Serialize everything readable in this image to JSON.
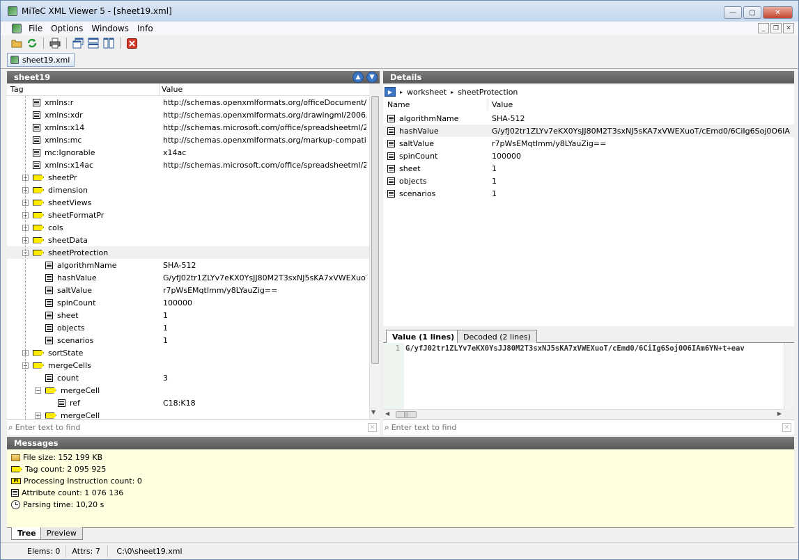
{
  "window": {
    "title": "MiTeC XML Viewer 5 - [sheet19.xml]"
  },
  "menu": [
    "File",
    "Options",
    "Windows",
    "Info"
  ],
  "doc_tab": {
    "label": "sheet19.xml"
  },
  "left_panel": {
    "title": "sheet19",
    "col_tag": "Tag",
    "col_value": "Value",
    "rows": [
      {
        "type": "attr",
        "tag": "xmlns:r",
        "value": "http://schemas.openxmlformats.org/officeDocument/200...",
        "depth": 1
      },
      {
        "type": "attr",
        "tag": "xmlns:xdr",
        "value": "http://schemas.openxmlformats.org/drawingml/2006/spr...",
        "depth": 1
      },
      {
        "type": "attr",
        "tag": "xmlns:x14",
        "value": "http://schemas.microsoft.com/office/spreadsheetml/2009...",
        "depth": 1
      },
      {
        "type": "attr",
        "tag": "xmlns:mc",
        "value": "http://schemas.openxmlformats.org/markup-compatibility...",
        "depth": 1
      },
      {
        "type": "attr",
        "tag": "mc:Ignorable",
        "value": "x14ac",
        "depth": 1
      },
      {
        "type": "attr",
        "tag": "xmlns:x14ac",
        "value": "http://schemas.microsoft.com/office/spreadsheetml/2009...",
        "depth": 1
      },
      {
        "type": "tag",
        "tag": "sheetPr",
        "value": "",
        "depth": 1,
        "exp": "+"
      },
      {
        "type": "tag",
        "tag": "dimension",
        "value": "",
        "depth": 1,
        "exp": "+"
      },
      {
        "type": "tag",
        "tag": "sheetViews",
        "value": "",
        "depth": 1,
        "exp": "+"
      },
      {
        "type": "tag",
        "tag": "sheetFormatPr",
        "value": "",
        "depth": 1,
        "exp": "+"
      },
      {
        "type": "tag",
        "tag": "cols",
        "value": "",
        "depth": 1,
        "exp": "+"
      },
      {
        "type": "tag",
        "tag": "sheetData",
        "value": "",
        "depth": 1,
        "exp": "+"
      },
      {
        "type": "tag",
        "tag": "sheetProtection",
        "value": "",
        "depth": 1,
        "exp": "-",
        "selected": true
      },
      {
        "type": "attr",
        "tag": "algorithmName",
        "value": "SHA-512",
        "depth": 2
      },
      {
        "type": "attr",
        "tag": "hashValue",
        "value": "G/yfJ02tr1ZLYv7eKX0YsJJ80M2T3sxNJ5sKA7xVWEXuoT/c...",
        "depth": 2
      },
      {
        "type": "attr",
        "tag": "saltValue",
        "value": "r7pWsEMqtImm/y8LYauZig==",
        "depth": 2
      },
      {
        "type": "attr",
        "tag": "spinCount",
        "value": "100000",
        "depth": 2
      },
      {
        "type": "attr",
        "tag": "sheet",
        "value": "1",
        "depth": 2
      },
      {
        "type": "attr",
        "tag": "objects",
        "value": "1",
        "depth": 2
      },
      {
        "type": "attr",
        "tag": "scenarios",
        "value": "1",
        "depth": 2
      },
      {
        "type": "tag",
        "tag": "sortState",
        "value": "",
        "depth": 1,
        "exp": "+"
      },
      {
        "type": "tag",
        "tag": "mergeCells",
        "value": "",
        "depth": 1,
        "exp": "-"
      },
      {
        "type": "attr",
        "tag": "count",
        "value": "3",
        "depth": 2
      },
      {
        "type": "tag",
        "tag": "mergeCell",
        "value": "",
        "depth": 2,
        "exp": "-"
      },
      {
        "type": "attr",
        "tag": "ref",
        "value": "C18:K18",
        "depth": 3
      },
      {
        "type": "tag",
        "tag": "mergeCell",
        "value": "",
        "depth": 2,
        "exp": "+"
      }
    ],
    "find_placeholder": "Enter text to find"
  },
  "right_panel": {
    "title": "Details",
    "breadcrumb": [
      "worksheet",
      "sheetProtection"
    ],
    "col_name": "Name",
    "col_value": "Value",
    "rows": [
      {
        "name": "algorithmName",
        "value": "SHA-512"
      },
      {
        "name": "hashValue",
        "value": "G/yfJ02tr1ZLYv7eKX0YsJJ80M2T3sxNJ5sKA7xVWEXuoT/cEmd0/6CiIg6Soj0O6IAm6YN...",
        "selected": true
      },
      {
        "name": "saltValue",
        "value": "r7pWsEMqtImm/y8LYauZig=="
      },
      {
        "name": "spinCount",
        "value": "100000"
      },
      {
        "name": "sheet",
        "value": "1"
      },
      {
        "name": "objects",
        "value": "1"
      },
      {
        "name": "scenarios",
        "value": "1"
      }
    ],
    "value_tabs": [
      "Value (1 lines)",
      "Decoded (2 lines)"
    ],
    "line_number": "1",
    "code_line": "G/yfJ02tr1ZLYv7eKX0YsJJ80M2T3sxNJ5sKA7xVWEXuoT/cEmd0/6CiIg6Soj0O6IAm6YN+t+eav",
    "find_placeholder": "Enter text to find"
  },
  "messages": {
    "title": "Messages",
    "items": [
      {
        "icon": "folder-icon",
        "text": "File size: 152 199 KB"
      },
      {
        "icon": "tag-icon",
        "text": "Tag count: 2 095 925"
      },
      {
        "icon": "pi-icon",
        "text": "Processing Instruction count: 0"
      },
      {
        "icon": "attribute-icon",
        "text": "Attribute count: 1 076 136"
      },
      {
        "icon": "clock-icon",
        "text": "Parsing time: 10,20 s"
      }
    ]
  },
  "bottom_tabs": [
    "Tree",
    "Preview"
  ],
  "status": {
    "elems": "Elems: 0",
    "attrs": "Attrs: 7",
    "path": "C:\\0\\sheet19.xml"
  }
}
